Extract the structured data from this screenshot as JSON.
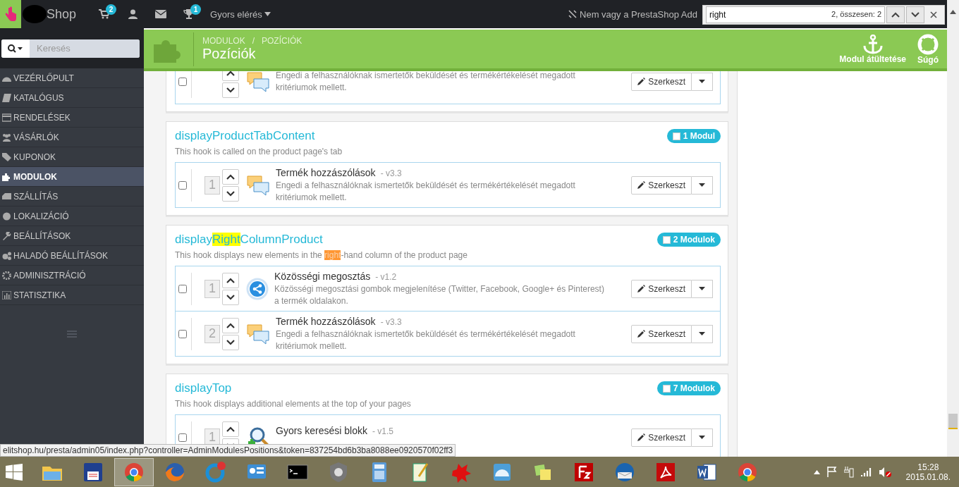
{
  "topbar": {
    "brand": "Shop",
    "icons": [
      {
        "kind": "cart",
        "count": "2"
      },
      {
        "kind": "user"
      },
      {
        "kind": "mail"
      },
      {
        "kind": "trophy",
        "count": "1"
      }
    ],
    "quick_access": "Gyors elérés",
    "addons_link": "Nem vagy a PrestaShop Add"
  },
  "find_bar": {
    "value": "right",
    "result": "2, összesen: 2"
  },
  "sidebar": {
    "search_placeholder": "Keresés",
    "items": [
      {
        "kind": "dashboard",
        "label": "VEZÉRLŐPULT",
        "selected": false
      },
      {
        "kind": "book",
        "label": "KATALÓGUS",
        "selected": false
      },
      {
        "kind": "card",
        "label": "RENDELÉSEK",
        "selected": false
      },
      {
        "kind": "users",
        "label": "VÁSÁRLÓK",
        "selected": false
      },
      {
        "kind": "tag",
        "label": "KUPONOK",
        "selected": false
      },
      {
        "kind": "puzzle",
        "label": "MODULOK",
        "selected": true
      },
      {
        "kind": "truck",
        "label": "SZÁLLÍTÁS",
        "selected": false
      },
      {
        "kind": "globe",
        "label": "LOKALIZÁCIÓ",
        "selected": false
      },
      {
        "kind": "wrench",
        "label": "BEÁLLÍTÁSOK",
        "selected": false
      },
      {
        "kind": "gears",
        "label": "HALADÓ BEÁLLÍTÁSOK",
        "selected": false
      },
      {
        "kind": "gear",
        "label": "ADMINISZTRÁCIÓ",
        "selected": false
      },
      {
        "kind": "chart",
        "label": "STATISZTIKA",
        "selected": false
      }
    ]
  },
  "header": {
    "breadcrumb": [
      "MODULOK",
      "POZÍCIÓK"
    ],
    "breadcrumb_separator": "/",
    "title": "Pozíciók",
    "actions": [
      {
        "kind": "anchor",
        "label": "Modul átültetése"
      },
      {
        "kind": "help",
        "label": "Súgó"
      }
    ]
  },
  "hooks": [
    {
      "modules": [
        {
          "checked": false,
          "kind": "comments",
          "description": "Engedi a felhasználóknak ismertetők beküldését és termékértékelését megadott kritériumok mellett.",
          "button": "Szerkeszt"
        }
      ]
    },
    {
      "title": [
        {
          "text": "displayProductTabContent",
          "highlighted": false,
          "current": false
        }
      ],
      "description": [
        {
          "text": "This hook is called on the product page's tab",
          "highlighted": false,
          "current": false
        }
      ],
      "badge": "1 Modul",
      "modules": [
        {
          "checked": false,
          "number": "1",
          "kind": "comments",
          "name": "Termék hozzászólások",
          "version": "- v3.3",
          "description": "Engedi a felhasználóknak ismertetők beküldését és termékértékelését megadott kritériumok mellett.",
          "button": "Szerkeszt"
        }
      ]
    },
    {
      "title": [
        {
          "text": "display",
          "highlighted": false,
          "current": false
        },
        {
          "text": "Right",
          "highlighted": true,
          "current": false
        },
        {
          "text": "ColumnProduct",
          "highlighted": false,
          "current": false
        }
      ],
      "description": [
        {
          "text": "This hook displays new elements in the ",
          "highlighted": false,
          "current": false
        },
        {
          "text": "right",
          "highlighted": true,
          "current": true
        },
        {
          "text": "-hand column of the product page",
          "highlighted": false,
          "current": false
        }
      ],
      "badge": "2 Modulok",
      "modules": [
        {
          "checked": false,
          "number": "1",
          "kind": "share",
          "name": "Közösségi megosztás",
          "version": "- v1.2",
          "description": "Közösségi megosztási gombok megjelenítése (Twitter, Facebook, Google+ és Pinterest) a termék oldalakon.",
          "button": "Szerkeszt"
        },
        {
          "checked": false,
          "number": "2",
          "kind": "comments",
          "name": "Termék hozzászólások",
          "version": "- v3.3",
          "description": "Engedi a felhasználóknak ismertetők beküldését és termékértékelését megadott kritériumok mellett.",
          "button": "Szerkeszt"
        }
      ]
    },
    {
      "title": [
        {
          "text": "displayTop",
          "highlighted": false,
          "current": false
        }
      ],
      "description": [
        {
          "text": "This hook displays additional elements at the top of your pages",
          "highlighted": false,
          "current": false
        }
      ],
      "badge": "7 Modulok",
      "modules": [
        {
          "checked": false,
          "number": "1",
          "kind": "search",
          "name": "Gyors keresési blokk",
          "version": "- v1.5",
          "button": "Szerkeszt"
        }
      ]
    }
  ],
  "status_url": "elitshop.hu/presta/admin05/index.php?controller=AdminModulesPositions&token=837254bd6b3ba8088ee0920570f02ff3",
  "taskbar": {
    "apps": [
      {
        "kind": "folder",
        "selected": false
      },
      {
        "kind": "floppy",
        "selected": false
      },
      {
        "kind": "chrome",
        "selected": true
      },
      {
        "kind": "firefox",
        "selected": false
      },
      {
        "kind": "sad-circle",
        "selected": false
      },
      {
        "kind": "panel",
        "selected": false
      },
      {
        "kind": "terminal",
        "selected": false
      },
      {
        "kind": "shield",
        "selected": false
      },
      {
        "kind": "calculator",
        "selected": false
      },
      {
        "kind": "notepad",
        "selected": false
      },
      {
        "kind": "splat",
        "selected": false
      },
      {
        "kind": "dome",
        "selected": false
      },
      {
        "kind": "notes",
        "selected": false
      },
      {
        "kind": "filezilla",
        "selected": false
      },
      {
        "kind": "mail-bird",
        "selected": false
      },
      {
        "kind": "pdf",
        "selected": false
      },
      {
        "kind": "word",
        "selected": false
      },
      {
        "kind": "chrome",
        "selected": false
      }
    ],
    "time": "15:28",
    "date": "2015.01.08."
  }
}
